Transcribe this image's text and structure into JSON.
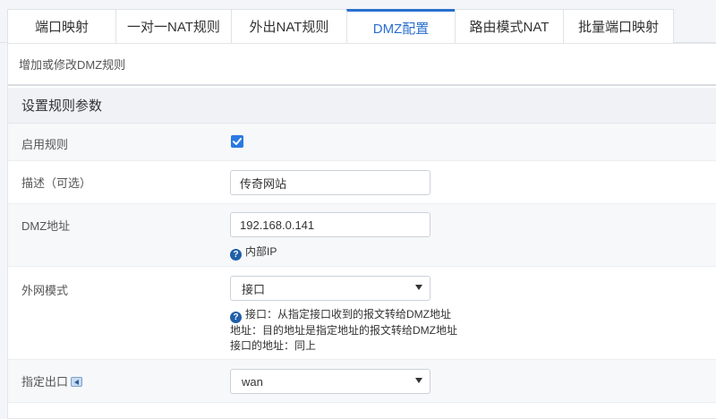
{
  "tabs": [
    {
      "label": "端口映射",
      "active": false
    },
    {
      "label": "一对一NAT规则",
      "active": false
    },
    {
      "label": "外出NAT规则",
      "active": false
    },
    {
      "label": "DMZ配置",
      "active": true
    },
    {
      "label": "路由模式NAT",
      "active": false
    },
    {
      "label": "批量端口映射",
      "active": false
    }
  ],
  "breadcrumb": "增加或修改DMZ规则",
  "section_title": "设置规则参数",
  "form": {
    "enable": {
      "label": "启用规则",
      "checked": true
    },
    "description": {
      "label": "描述（可选）",
      "value": "传奇网站"
    },
    "dmz_address": {
      "label": "DMZ地址",
      "value": "192.168.0.141",
      "hint": "内部IP"
    },
    "wan_mode": {
      "label": "外网模式",
      "value": "接口",
      "hints": [
        "接口：从指定接口收到的报文转给DMZ地址",
        "地址：目的地址是指定地址的报文转给DMZ地址",
        "接口的地址：同上"
      ]
    },
    "egress": {
      "label": "指定出口",
      "value": "wan"
    }
  },
  "colors": {
    "accent": "#2a6fcf",
    "checkbox": "#2a7ae2",
    "help_icon": "#1f5fa8"
  }
}
